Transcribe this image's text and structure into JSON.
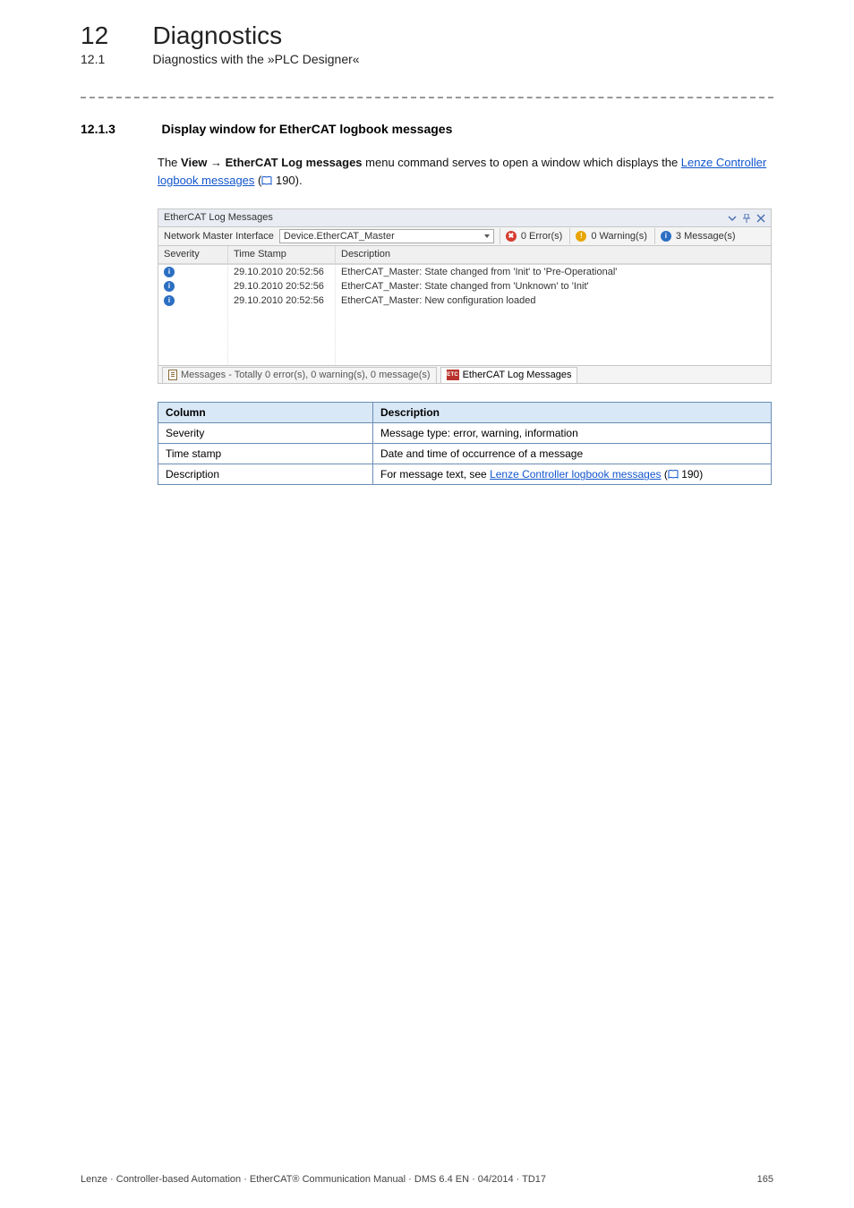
{
  "header": {
    "chapter_num": "12",
    "chapter_title": "Diagnostics",
    "section_num": "12.1",
    "section_title": "Diagnostics with the »PLC Designer«"
  },
  "subsection": {
    "num": "12.1.3",
    "title": "Display window for EtherCAT logbook messages"
  },
  "intro": {
    "part1": "The ",
    "bold": "View → EtherCAT Log messages",
    "part2": " menu command serves to open a window which displays the ",
    "link": "Lenze Controller logbook messages",
    "pageref": " 190).",
    "open_paren": " ("
  },
  "panel": {
    "title": "EtherCAT Log Messages",
    "toolbar": {
      "label": "Network Master Interface",
      "dropdown_value": "Device.EtherCAT_Master",
      "errors": "0 Error(s)",
      "warnings": "0 Warning(s)",
      "messages": "3 Message(s)"
    },
    "columns": {
      "c1": "Severity",
      "c2": "Time Stamp",
      "c3": "Description"
    },
    "rows": [
      {
        "ts": "29.10.2010 20:52:56",
        "desc": "EtherCAT_Master: State changed from 'Init' to 'Pre-Operational'"
      },
      {
        "ts": "29.10.2010 20:52:56",
        "desc": "EtherCAT_Master: State changed from 'Unknown' to 'Init'"
      },
      {
        "ts": "29.10.2010 20:52:56",
        "desc": "EtherCAT_Master: New configuration loaded"
      }
    ],
    "tabs": {
      "messages": "Messages - Totally 0 error(s), 0 warning(s), 0 message(s)",
      "ethercat": "EtherCAT Log Messages"
    }
  },
  "desc_table": {
    "h1": "Column",
    "h2": "Description",
    "r1c1": "Severity",
    "r1c2": "Message type: error, warning, information",
    "r2c1": "Time stamp",
    "r2c2": "Date and time of occurrence of a message",
    "r3c1": "Description",
    "r3c2_pre": "For message text, see ",
    "r3c2_link": "Lenze Controller logbook messages",
    "r3c2_paren_open": " (",
    "r3c2_pageref": " 190)"
  },
  "footer": {
    "left": "Lenze · Controller-based Automation · EtherCAT® Communication Manual · DMS 6.4 EN · 04/2014 · TD17",
    "page": "165"
  }
}
